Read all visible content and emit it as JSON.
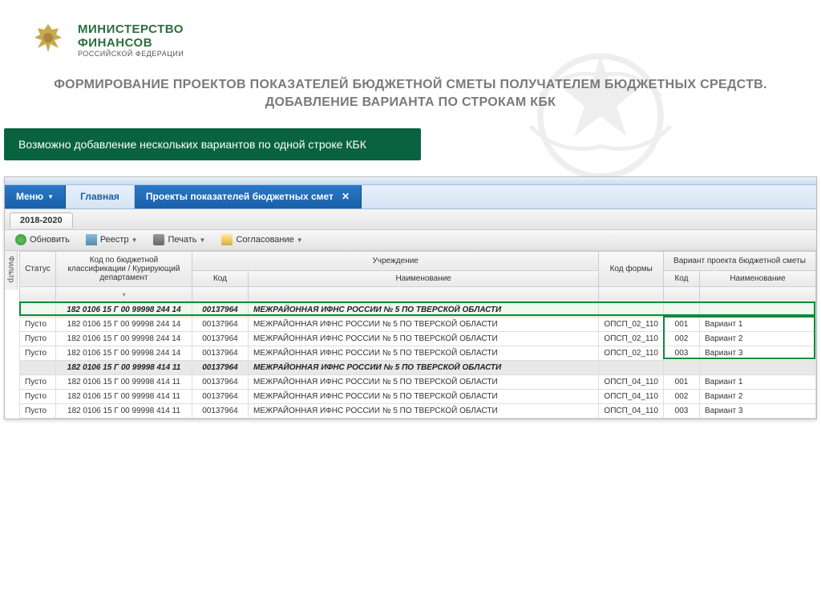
{
  "logo": {
    "line1": "МИНИСТЕРСТВО",
    "line2": "ФИНАНСОВ",
    "line3": "РОССИЙСКОЙ ФЕДЕРАЦИИ"
  },
  "slide_title": "ФОРМИРОВАНИЕ ПРОЕКТОВ ПОКАЗАТЕЛЕЙ БЮДЖЕТНОЙ СМЕТЫ ПОЛУЧАТЕЛЕМ БЮДЖЕТНЫХ СРЕДСТВ. ДОБАВЛЕНИЕ ВАРИАНТА ПО СТРОКАМ КБК",
  "callout_text": "Возможно добавление нескольких вариантов по одной строке КБК",
  "tabs": {
    "menu": "Меню",
    "home": "Главная",
    "active": "Проекты показателей бюджетных смет"
  },
  "subtab": "2018-2020",
  "toolbar": {
    "refresh": "Обновить",
    "registry": "Реестр",
    "print": "Печать",
    "approval": "Согласование"
  },
  "filter_label": "Фильтр",
  "columns": {
    "status": "Статус",
    "kbk": "Код по бюджетной классификации / Курирующий департамент",
    "institution": "Учреждение",
    "inst_code": "Код",
    "inst_name": "Наименование",
    "form_code": "Код формы",
    "variant": "Вариант проекта бюджетной сметы",
    "var_code": "Код",
    "var_name": "Наименование"
  },
  "groups": [
    {
      "kbk": "182 0106 15 Г 00 99998 244 14",
      "code": "00137964",
      "name": "МЕЖРАЙОННАЯ ИФНС РОССИИ № 5 ПО ТВЕРСКОЙ ОБЛАСТИ",
      "highlight": true,
      "rows": [
        {
          "status": "Пусто",
          "kbk": "182 0106 15 Г 00 99998 244 14",
          "code": "00137964",
          "name": "МЕЖРАЙОННАЯ ИФНС РОССИИ № 5 ПО ТВЕРСКОЙ ОБЛАСТИ",
          "form": "ОПСП_02_110",
          "vcode": "001",
          "vname": "Вариант 1"
        },
        {
          "status": "Пусто",
          "kbk": "182 0106 15 Г 00 99998 244 14",
          "code": "00137964",
          "name": "МЕЖРАЙОННАЯ ИФНС РОССИИ № 5 ПО ТВЕРСКОЙ ОБЛАСТИ",
          "form": "ОПСП_02_110",
          "vcode": "002",
          "vname": "Вариант 2"
        },
        {
          "status": "Пусто",
          "kbk": "182 0106 15 Г 00 99998 244 14",
          "code": "00137964",
          "name": "МЕЖРАЙОННАЯ ИФНС РОССИИ № 5 ПО ТВЕРСКОЙ ОБЛАСТИ",
          "form": "ОПСП_02_110",
          "vcode": "003",
          "vname": "Вариант 3"
        }
      ]
    },
    {
      "kbk": "182 0106 15 Г 00 99998 414 11",
      "code": "00137964",
      "name": "МЕЖРАЙОННАЯ ИФНС РОССИИ № 5 ПО ТВЕРСКОЙ ОБЛАСТИ",
      "highlight": false,
      "rows": [
        {
          "status": "Пусто",
          "kbk": "182 0106 15 Г 00 99998 414 11",
          "code": "00137964",
          "name": "МЕЖРАЙОННАЯ ИФНС РОССИИ № 5 ПО ТВЕРСКОЙ ОБЛАСТИ",
          "form": "ОПСП_04_110",
          "vcode": "001",
          "vname": "Вариант 1"
        },
        {
          "status": "Пусто",
          "kbk": "182 0106 15 Г 00 99998 414 11",
          "code": "00137964",
          "name": "МЕЖРАЙОННАЯ ИФНС РОССИИ № 5 ПО ТВЕРСКОЙ ОБЛАСТИ",
          "form": "ОПСП_04_110",
          "vcode": "002",
          "vname": "Вариант 2"
        },
        {
          "status": "Пусто",
          "kbk": "182 0106 15 Г 00 99998 414 11",
          "code": "00137964",
          "name": "МЕЖРАЙОННАЯ ИФНС РОССИИ № 5 ПО ТВЕРСКОЙ ОБЛАСТИ",
          "form": "ОПСП_04_110",
          "vcode": "003",
          "vname": "Вариант 3"
        }
      ]
    }
  ]
}
